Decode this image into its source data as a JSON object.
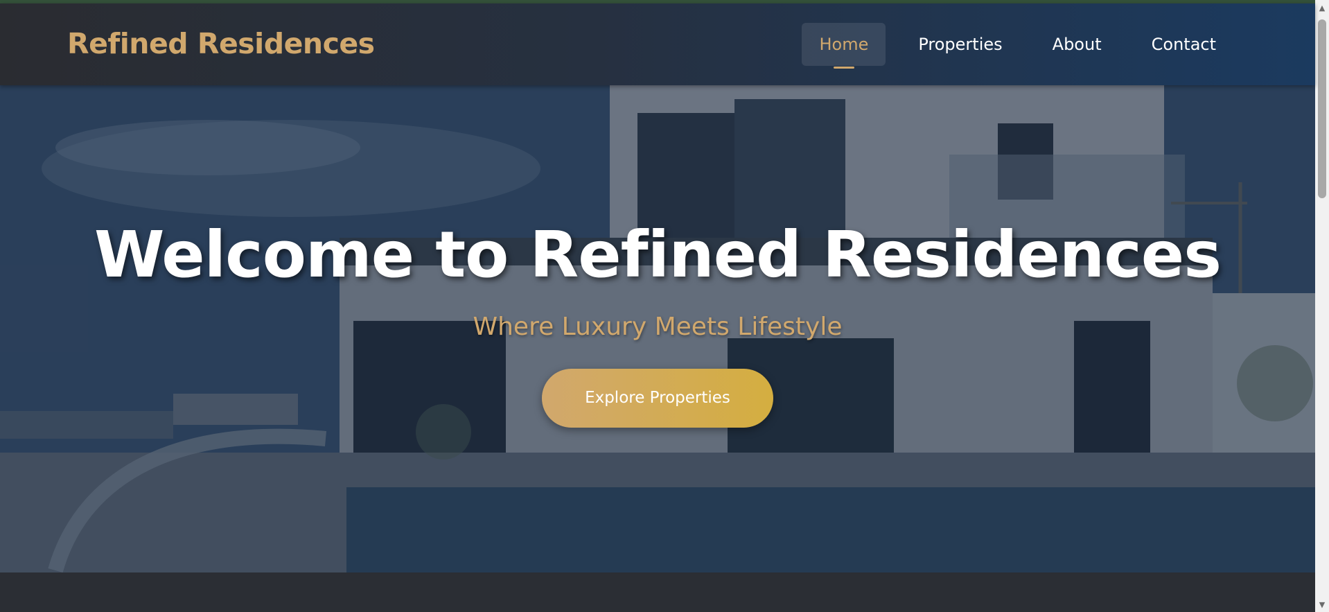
{
  "brand": {
    "name": "Refined Residences"
  },
  "nav": {
    "items": [
      {
        "label": "Home",
        "active": true
      },
      {
        "label": "Properties",
        "active": false
      },
      {
        "label": "About",
        "active": false
      },
      {
        "label": "Contact",
        "active": false
      }
    ]
  },
  "hero": {
    "title": "Welcome to Refined Residences",
    "subtitle": "Where Luxury Meets Lifestyle",
    "cta_label": "Explore Properties"
  },
  "colors": {
    "accent_gold": "#d1a86d",
    "cta_gold_end": "#d4ae40",
    "nav_dark": "#2a2c31",
    "nav_blue": "#1b3a5f",
    "page_bg": "#2b2e34"
  },
  "scrollbar": {
    "up_icon": "triangle-up-icon",
    "down_icon": "triangle-down-icon"
  }
}
